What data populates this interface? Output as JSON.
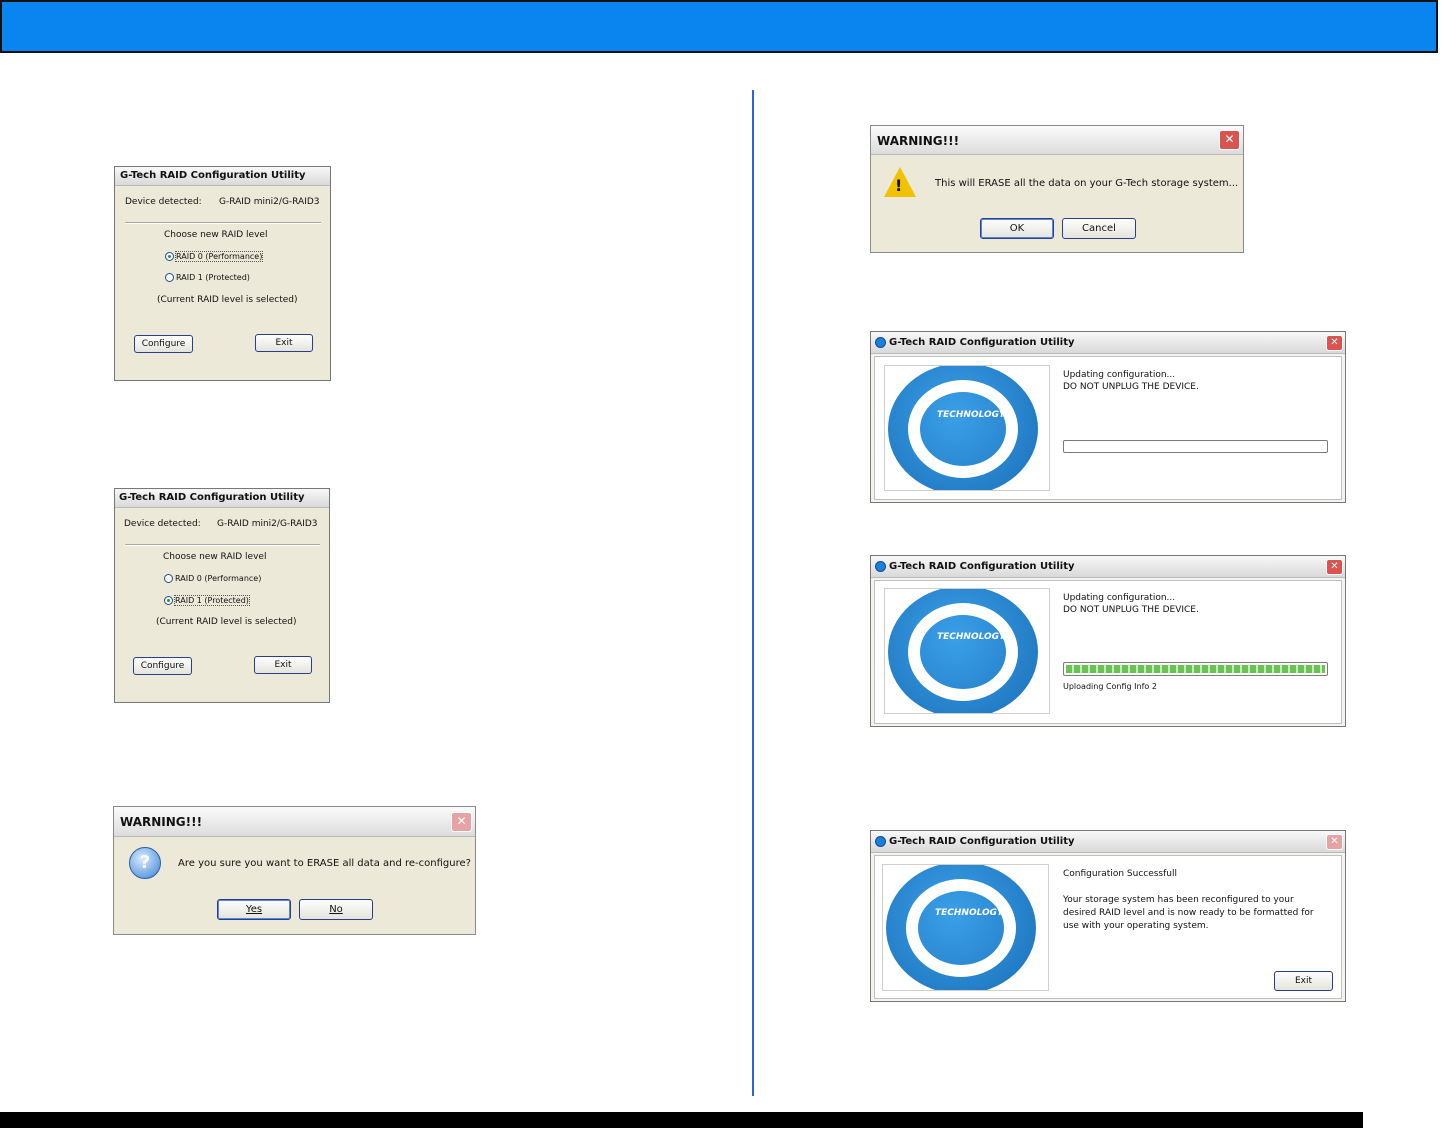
{
  "dialogs": {
    "raid0": {
      "title": "G-Tech RAID Configuration Utility",
      "device_label": "Device detected:",
      "device_value": "G-RAID mini2/G-RAID3",
      "choose_label": "Choose new RAID level",
      "option0": "RAID 0 (Performance)",
      "option1": "RAID 1 (Protected)",
      "note": "(Current RAID level is selected)",
      "configure": "Configure",
      "exit": "Exit"
    },
    "raid1": {
      "title": "G-Tech RAID Configuration Utility",
      "device_label": "Device detected:",
      "device_value": "G-RAID mini2/G-RAID3",
      "choose_label": "Choose new RAID level",
      "option0": "RAID 0 (Performance)",
      "option1": "RAID 1 (Protected)",
      "note": "(Current RAID level is selected)",
      "configure": "Configure",
      "exit": "Exit"
    },
    "confirm": {
      "title": "WARNING!!!",
      "message": "Are you sure you want to ERASE all data and re-configure?",
      "yes": "Yes",
      "no": "No"
    },
    "erase_warning": {
      "title": "WARNING!!!",
      "message": "This will ERASE all the data on your G-Tech storage system...",
      "ok": "OK",
      "cancel": "Cancel"
    },
    "progress_empty": {
      "title": "G-Tech RAID Configuration Utility",
      "line1": "Updating configuration...",
      "line2": "DO NOT UNPLUG THE DEVICE.",
      "progress": 0,
      "logo_text": "TECHNOLOGY"
    },
    "progress_full": {
      "title": "G-Tech RAID Configuration Utility",
      "line1": "Updating configuration...",
      "line2": "DO NOT UNPLUG THE DEVICE.",
      "progress": 100,
      "status": "Uploading Config Info 2",
      "logo_text": "TECHNOLOGY"
    },
    "success": {
      "title": "G-Tech RAID Configuration Utility",
      "heading": "Configuration Successfull",
      "body1": "Your storage system has been reconfigured to your",
      "body2": "desired RAID level and is now ready to be formatted for",
      "body3": "use with your operating system.",
      "exit": "Exit",
      "logo_text": "TECHNOLOGY"
    }
  },
  "colors": {
    "header": "#0a85f0",
    "divider": "#2e62d6"
  }
}
